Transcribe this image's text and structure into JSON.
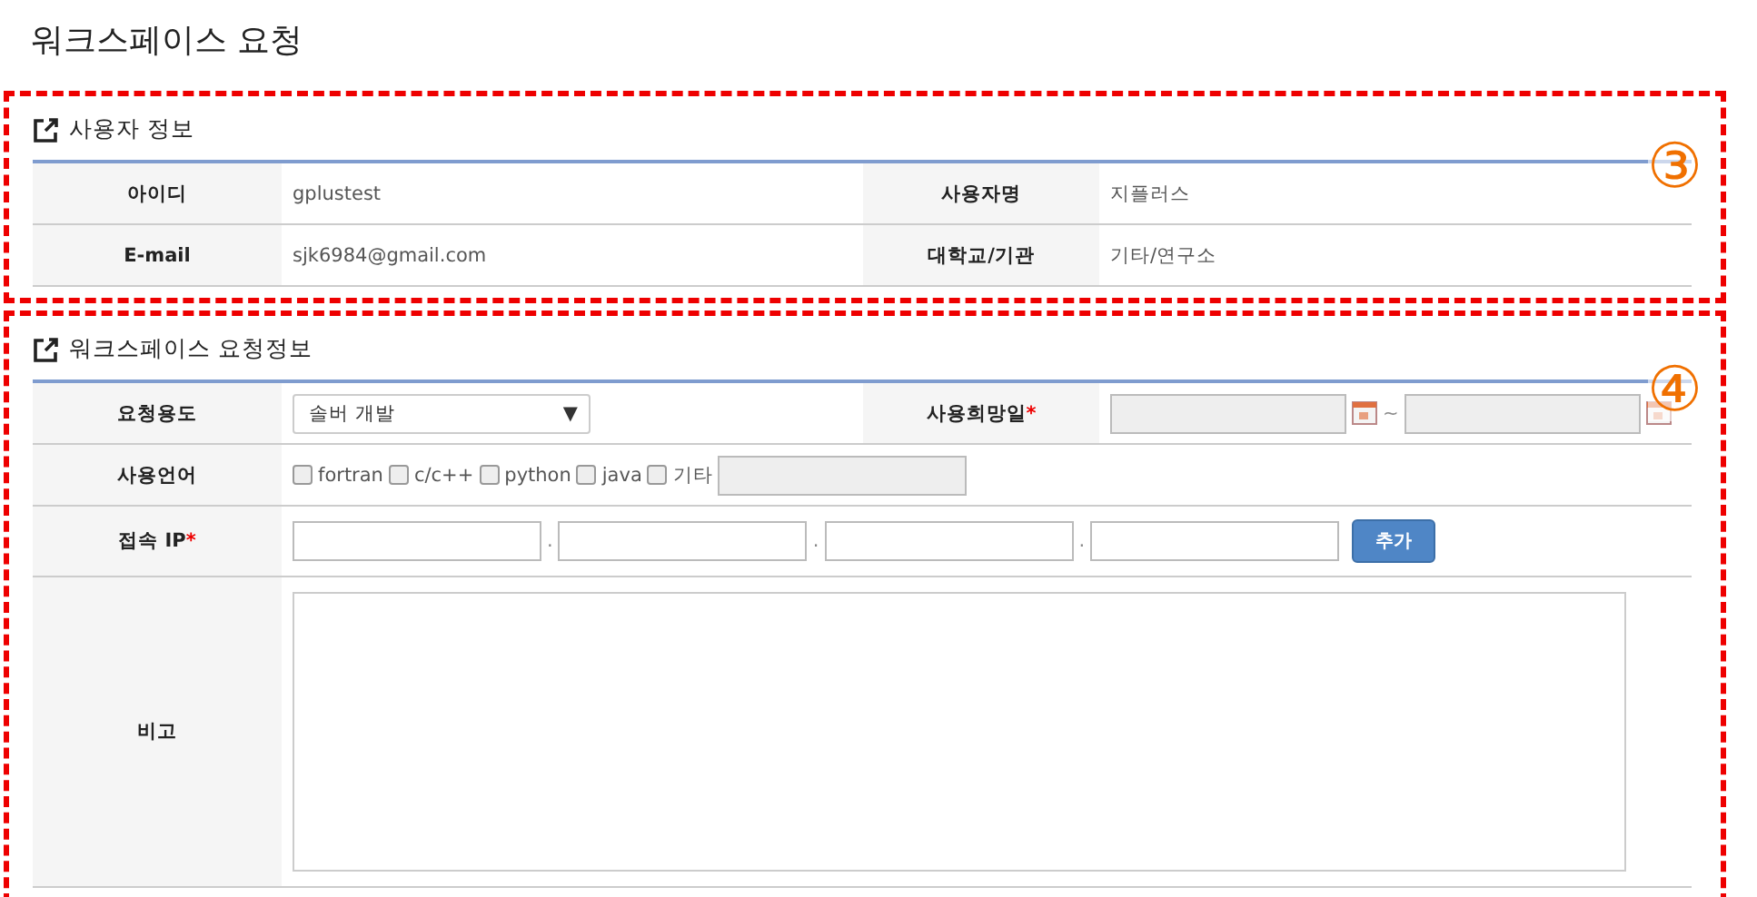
{
  "page_title": "워크스페이스 요청",
  "sections": [
    {
      "title": "사용자 정보",
      "marker": "③",
      "rows": [
        {
          "cells": [
            {
              "label": "아이디",
              "value": "gplustest"
            },
            {
              "label": "사용자명",
              "value": "지플러스"
            }
          ]
        },
        {
          "cells": [
            {
              "label": "E-mail",
              "value": "sjk6984@gmail.com"
            },
            {
              "label": "대학교/기관",
              "value": "기타/연구소"
            }
          ]
        }
      ]
    },
    {
      "title": "워크스페이스 요청정보",
      "marker": "④",
      "form": {
        "purpose": {
          "label": "요청용도",
          "value": "솔버 개발",
          "caret": "▼"
        },
        "date": {
          "label": "사용희망일",
          "required": "*",
          "separator": "~",
          "disabled": true
        },
        "languages": {
          "label": "사용언어",
          "options": [
            {
              "label": "fortran",
              "checked": false
            },
            {
              "label": "c/c++",
              "checked": false
            },
            {
              "label": "python",
              "checked": false
            },
            {
              "label": "java",
              "checked": false
            },
            {
              "label": "기타",
              "checked": false
            }
          ],
          "other_disabled": true
        },
        "ip": {
          "label": "접속 IP",
          "required": "*",
          "separators": [
            ".",
            ".",
            "."
          ],
          "button": "추가"
        },
        "notes": {
          "label": "비고"
        }
      }
    }
  ]
}
